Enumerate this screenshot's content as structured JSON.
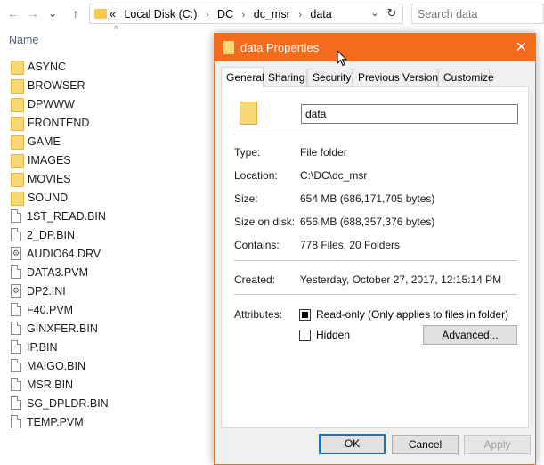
{
  "explorer": {
    "back_glyph": "←",
    "forward_glyph": "→",
    "recent_glyph": "⌄",
    "up_glyph": "↑",
    "address": {
      "prefix": "«",
      "crumbs": [
        "Local Disk (C:)",
        "DC",
        "dc_msr",
        "data"
      ],
      "separator": "›",
      "dropdown_glyph": "⌄",
      "refresh_glyph": "↻"
    },
    "search_placeholder": "Search data",
    "column_header": "Name",
    "sort_glyph": "^",
    "files": [
      {
        "name": "ASYNC",
        "icon": "folder-icon"
      },
      {
        "name": "BROWSER",
        "icon": "folder-icon"
      },
      {
        "name": "DPWWW",
        "icon": "folder-icon"
      },
      {
        "name": "FRONTEND",
        "icon": "folder-icon"
      },
      {
        "name": "GAME",
        "icon": "folder-icon"
      },
      {
        "name": "IMAGES",
        "icon": "folder-icon"
      },
      {
        "name": "MOVIES",
        "icon": "folder-icon"
      },
      {
        "name": "SOUND",
        "icon": "folder-icon"
      },
      {
        "name": "1ST_READ.BIN",
        "icon": "file-icon"
      },
      {
        "name": "2_DP.BIN",
        "icon": "file-icon"
      },
      {
        "name": "AUDIO64.DRV",
        "icon": "settings-file-icon"
      },
      {
        "name": "DATA3.PVM",
        "icon": "file-icon"
      },
      {
        "name": "DP2.INI",
        "icon": "settings-file-icon"
      },
      {
        "name": "F40.PVM",
        "icon": "file-icon"
      },
      {
        "name": "GINXFER.BIN",
        "icon": "file-icon"
      },
      {
        "name": "IP.BIN",
        "icon": "file-icon"
      },
      {
        "name": "MAIGO.BIN",
        "icon": "file-icon"
      },
      {
        "name": "MSR.BIN",
        "icon": "file-icon"
      },
      {
        "name": "SG_DPLDR.BIN",
        "icon": "file-icon"
      },
      {
        "name": "TEMP.PVM",
        "icon": "file-icon"
      }
    ]
  },
  "dialog": {
    "title": "data Properties",
    "close_glyph": "✕",
    "accent": "#f26c1d",
    "tabs": [
      "General",
      "Sharing",
      "Security",
      "Previous Versions",
      "Customize"
    ],
    "active_tab": "General",
    "name_value": "data",
    "type": {
      "label": "Type:",
      "value": "File folder"
    },
    "location": {
      "label": "Location:",
      "value": "C:\\DC\\dc_msr"
    },
    "size": {
      "label": "Size:",
      "value": "654 MB (686,171,705 bytes)"
    },
    "size_on_disk": {
      "label": "Size on disk:",
      "value": "656 MB (688,357,376 bytes)"
    },
    "contains": {
      "label": "Contains:",
      "value": "778 Files, 20 Folders"
    },
    "created": {
      "label": "Created:",
      "value": "Yesterday, October 27, 2017, 12:15:14 PM"
    },
    "attributes": {
      "label": "Attributes:",
      "readonly_label": "Read-only (Only applies to files in folder)",
      "readonly_state": "indeterminate",
      "hidden_label": "Hidden",
      "hidden_checked": false,
      "advanced_button": "Advanced..."
    },
    "buttons": {
      "ok": "OK",
      "cancel": "Cancel",
      "apply": "Apply"
    }
  }
}
